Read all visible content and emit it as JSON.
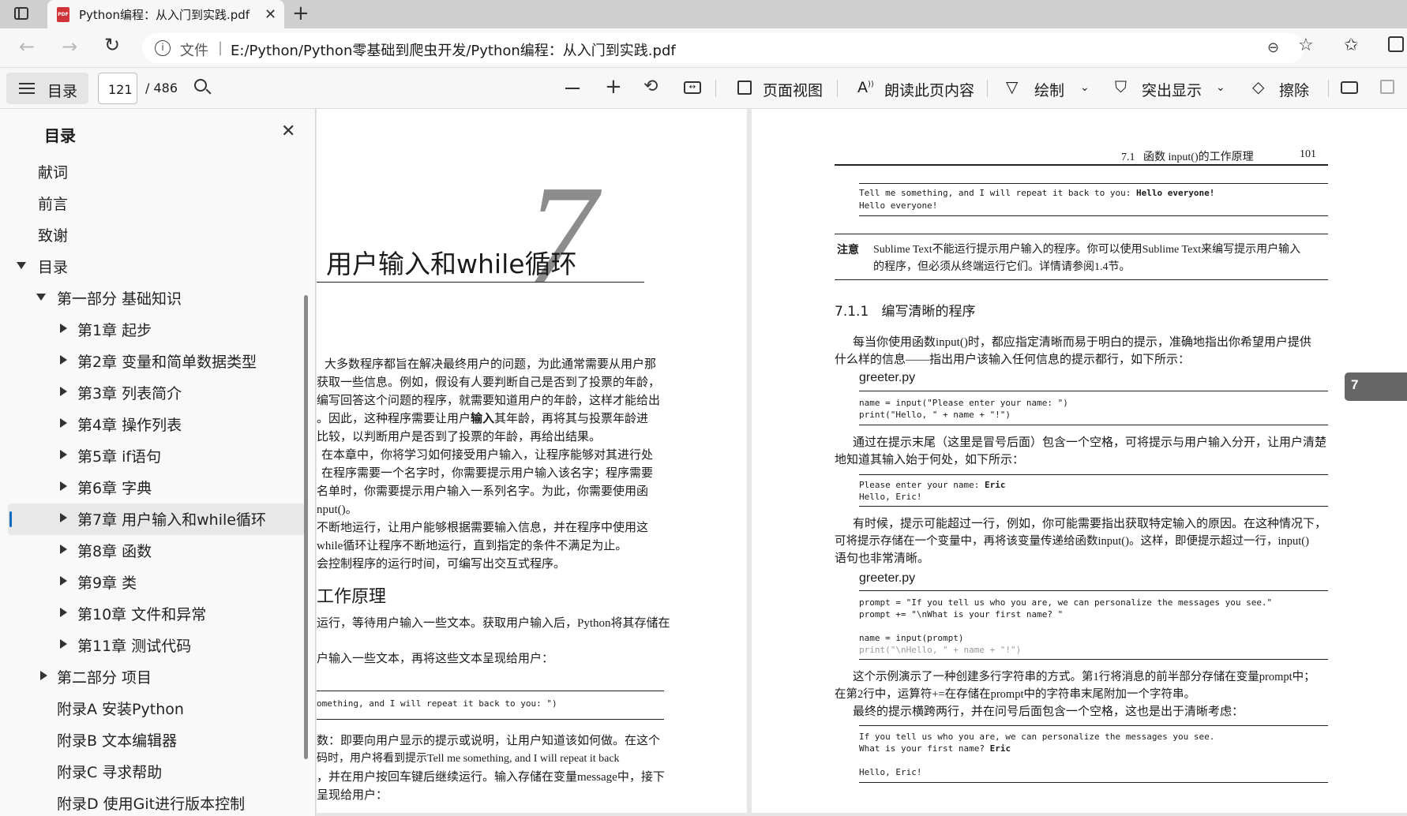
{
  "browser": {
    "tab_title": "Python编程：从入门到实践.pdf",
    "url_label": "文件",
    "url": "E:/Python/Python零基础到爬虫开发/Python编程：从入门到实践.pdf"
  },
  "toolbar": {
    "toc_label": "目录",
    "page_current": "121",
    "page_total": "/ 486",
    "page_view_label": "页面视图",
    "read_aloud_label": "朗读此页内容",
    "draw_label": "绘制",
    "highlight_label": "突出显示",
    "erase_label": "擦除"
  },
  "sidebar": {
    "title": "目录",
    "items": [
      {
        "label": "献词"
      },
      {
        "label": "前言"
      },
      {
        "label": "致谢"
      },
      {
        "label": "目录"
      },
      {
        "label": "第一部分 基础知识"
      },
      {
        "label": "第1章 起步"
      },
      {
        "label": "第2章 变量和简单数据类型"
      },
      {
        "label": "第3章 列表简介"
      },
      {
        "label": "第4章 操作列表"
      },
      {
        "label": "第5章 if语句"
      },
      {
        "label": "第6章 字典"
      },
      {
        "label": "第7章 用户输入和while循环"
      },
      {
        "label": "第8章 函数"
      },
      {
        "label": "第9章 类"
      },
      {
        "label": "第10章 文件和异常"
      },
      {
        "label": "第11章 测试代码"
      },
      {
        "label": "第二部分 项目"
      },
      {
        "label": "附录A 安装Python"
      },
      {
        "label": "附录B 文本编辑器"
      },
      {
        "label": "附录C 寻求帮助"
      },
      {
        "label": "附录D 使用Git进行版本控制"
      }
    ]
  },
  "left_page": {
    "chapter_number": "7",
    "chapter_title": "用户输入和while循环",
    "paragraphs": [
      "大多数程序都旨在解决最终用户的问题，为此通常需要从用户那",
      "获取一些信息。例如，假设有人要判断自己是否到了投票的年龄，",
      "编写回答这个问题的程序，就需要知道用户的年龄，这样才能给出",
      "。因此，这种程序需要让用户",
      "输入",
      "其年龄，再将其与投票年龄进",
      "比较，以判断用户是否到了投票的年龄，再给出结果。",
      "在本章中，你将学习如何接受用户输入，让程序能够对其进行处",
      "在程序需要一个名字时，你需要提示用户输入该名字；程序需要",
      "名单时，你需要提示用户输入一系列名字。为此，你需要使用函",
      "nput()。",
      "不断地运行，让用户能够根据需要输入信息，并在程序中使用这",
      "while循环让程序不断地运行，直到指定的条件不满足为止。",
      "会控制程序的运行时间，可编写出交互式程序。"
    ],
    "section_heading": "工作原理",
    "body2": [
      "运行，等待用户输入一些文本。获取用户输入后，Python将其存储在",
      "户输入一些文本，再将这些文本呈现给用户："
    ],
    "code1": "omething, and I will repeat it back to you: \")",
    "body3": [
      "数：即要向用户显示的提示或说明，让用户知道该如何做。在这个",
      "码时，用户将看到提示Tell me something, and I will repeat it back",
      "，并在用户按回车键后继续运行。输入存储在变量message中，接下",
      "呈现给用户："
    ]
  },
  "right_page": {
    "header_section": "7.1",
    "header_title": "函数 input()的工作原理",
    "page_number": "101",
    "output1_prompt": "Tell me something, and I will repeat it back to you: ",
    "output1_input": "Hello everyone!",
    "output1_echo": "Hello everyone!",
    "note_label": "注意",
    "note_lines": [
      "Sublime Text不能运行提示用户输入的程序。你可以使用Sublime Text来编写提示用户输入",
      "的程序，但必须从终端运行它们。详情请参阅1.4节。"
    ],
    "subsection_number": "7.1.1",
    "subsection_title": "编写清晰的程序",
    "para1": [
      "每当你使用函数input()时，都应指定清晰而易于明白的提示，准确地指出你希望用户提供",
      "什么样的信息——指出用户该输入任何信息的提示都行，如下所示："
    ],
    "file1": "greeter.py",
    "code1": [
      "name = input(\"Please enter your name: \")",
      "print(\"Hello, \" + name + \"!\")"
    ],
    "para2": [
      "通过在提示末尾（这里是冒号后面）包含一个空格，可将提示与用户输入分开，让用户清楚",
      "地知道其输入始于何处，如下所示："
    ],
    "output2_prompt": "Please enter your name: ",
    "output2_input": "Eric",
    "output2_echo": "Hello, Eric!",
    "para3": [
      "有时候，提示可能超过一行，例如，你可能需要指出获取特定输入的原因。在这种情况下，",
      "可将提示存储在一个变量中，再将该变量传递给函数input()。这样，即便提示超过一行，input()",
      "语句也非常清晰。"
    ],
    "file2": "greeter.py",
    "code2": [
      "prompt = \"If you tell us who you are, we can personalize the messages you see.\"",
      "prompt += \"\\nWhat is your first name? \"",
      "",
      "name = input(prompt)",
      "print(\"\\nHello, \" + name + \"!\")"
    ],
    "para4": [
      "这个示例演示了一种创建多行字符串的方式。第1行将消息的前半部分存储在变量prompt中；",
      "在第2行中，运算符+=在存储在prompt中的字符串末尾附加一个字符串。",
      "最终的提示横跨两行，并在问号后面包含一个空格，这也是出于清晰考虑："
    ],
    "output3_line1": "If you tell us who you are, we can personalize the messages you see.",
    "output3_prompt": "What is your first name? ",
    "output3_input": "Eric",
    "output3_echo": "Hello, Eric!",
    "chapter_tab": "7"
  }
}
